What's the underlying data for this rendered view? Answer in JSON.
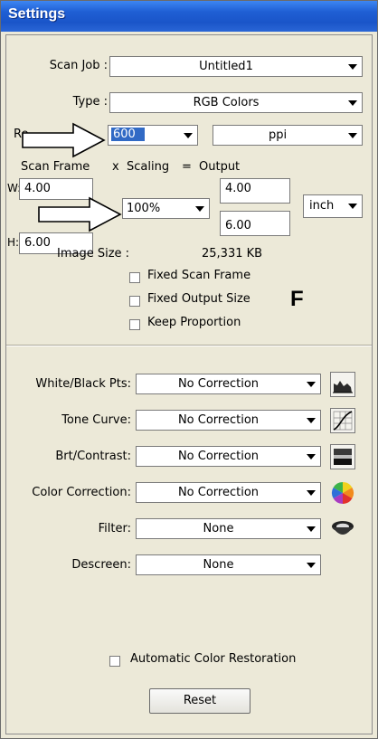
{
  "window": {
    "title": "Settings"
  },
  "scan_job": {
    "label": "Scan Job :",
    "value": "Untitled1"
  },
  "type": {
    "label": "Type :",
    "value": "RGB Colors"
  },
  "resolution": {
    "label": "Re",
    "value": "600",
    "unit": "ppi"
  },
  "frame_headers": {
    "scan_frame": "Scan Frame",
    "x": "x",
    "scaling": "Scaling",
    "eq": "=",
    "output": "Output"
  },
  "size": {
    "w_label": "W:",
    "w_value": "4.00",
    "h_label": "H:",
    "h_value": "6.00",
    "scaling_value": "100%",
    "out_w": "4.00",
    "out_h": "6.00",
    "unit": "inch"
  },
  "image_size": {
    "label": "Image Size :",
    "value": "25,331 KB"
  },
  "options": [
    {
      "label": "Fixed Scan Frame",
      "checked": false
    },
    {
      "label": "Fixed Output Size",
      "checked": false
    },
    {
      "label": "Keep Proportion",
      "checked": false
    }
  ],
  "f_badge": "F",
  "corrections": [
    {
      "label": "White/Black Pts:",
      "value": "No Correction",
      "icon": "histogram-icon"
    },
    {
      "label": "Tone Curve:",
      "value": "No Correction",
      "icon": "tone-curve-icon"
    },
    {
      "label": "Brt/Contrast:",
      "value": "No Correction",
      "icon": "brightness-contrast-icon"
    },
    {
      "label": "Color Correction:",
      "value": "No Correction",
      "icon": "color-wheel-icon"
    },
    {
      "label": "Filter:",
      "value": "None",
      "icon": "filter-lens-icon"
    },
    {
      "label": "Descreen:",
      "value": "None"
    }
  ],
  "auto_restore": {
    "label": "Automatic Color Restoration",
    "checked": false
  },
  "reset_label": "Reset"
}
